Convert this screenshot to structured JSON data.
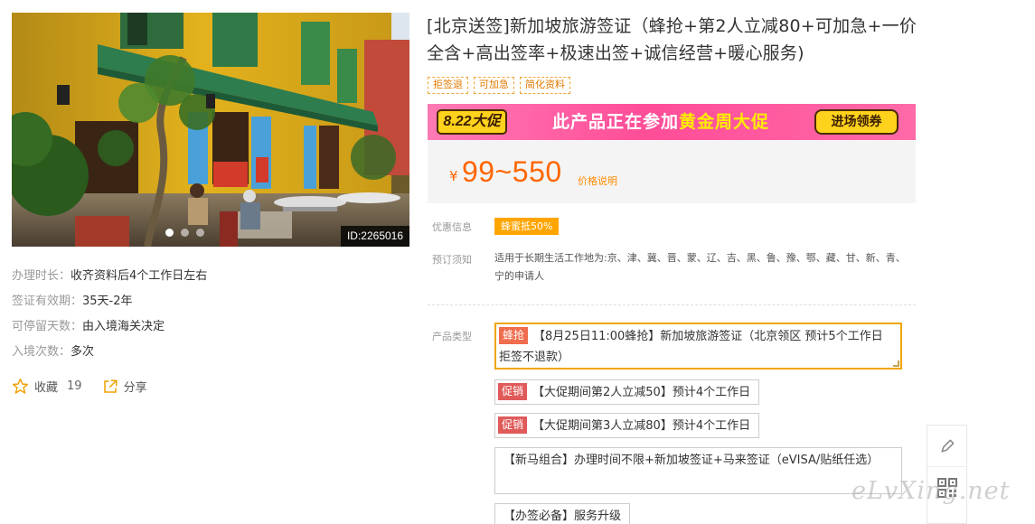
{
  "photo": {
    "id_label": "ID:2265016",
    "slide_count": 3,
    "active_slide": 1
  },
  "left_info": [
    {
      "label": "办理时长：",
      "value": "收齐资料后4个工作日左右"
    },
    {
      "label": "签证有效期：",
      "value": "35天-2年"
    },
    {
      "label": "可停留天数：",
      "value": "由入境海关决定"
    },
    {
      "label": "入境次数：",
      "value": "多次"
    }
  ],
  "actions": {
    "favorite_label": "收藏",
    "favorite_count": "19",
    "share_label": "分享",
    "favorite_icon": "star-outline-icon",
    "share_icon": "share-external-icon"
  },
  "title": "[北京送签]新加坡旅游签证（蜂抢+第2人立减80+可加急+一价全含+高出签率+极速出签+诚信经营+暖心服务)",
  "tags": [
    "拒签退",
    "可加急",
    "简化资料"
  ],
  "promo": {
    "badge": "8.22大促",
    "text_prefix": "此产品正在参加",
    "text_highlight": "黄金周大促",
    "button": "进场领券"
  },
  "price": {
    "currency": "¥",
    "value": "99~550",
    "note": "价格说明"
  },
  "discount": {
    "label": "优惠信息",
    "badge": "蜂蜜抵50%"
  },
  "notice": {
    "label": "预订须知",
    "text": "适用于长期生活工作地为:京、津、冀、晋、蒙、辽、吉、黑、鲁、豫、鄂、藏、甘、新、青、宁的申请人"
  },
  "product_type": {
    "label": "产品类型",
    "options": [
      {
        "tag": "蜂抢",
        "text": "【8月25日11:00蜂抢】新加坡旅游签证（北京领区 预计5个工作日拒签不退款）",
        "selected": true
      },
      {
        "tag": "促销",
        "text": "【大促期间第2人立减50】预计4个工作日",
        "selected": false
      },
      {
        "tag": "促销",
        "text": "【大促期间第3人立减80】预计4个工作日",
        "selected": false
      },
      {
        "tag": "",
        "text": "【新马组合】办理时间不限+新加坡签证+马来签证（eVISA/贴纸任选）",
        "selected": false
      },
      {
        "tag": "",
        "text": "【办签必备】服务升级",
        "selected": false
      }
    ]
  },
  "side_tools": {
    "edit_icon": "pencil-icon",
    "qr_icon": "qrcode-icon"
  },
  "watermark": "eLvXing.net",
  "colors": {
    "price": "#ff6600",
    "tag_border": "#f0a53a",
    "promo_pink": "#ff4d98",
    "promo_yellow": "#ffd21d",
    "selected_border": "#f0a500",
    "discount_badge": "#ffa500"
  }
}
